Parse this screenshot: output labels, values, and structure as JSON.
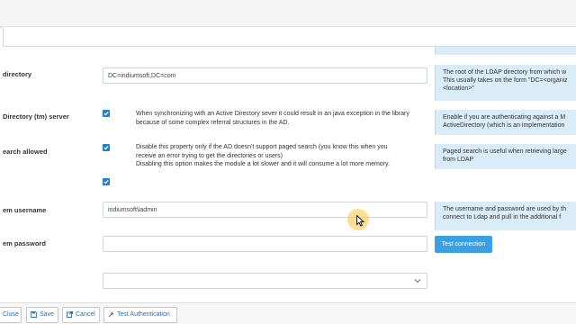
{
  "fields": [
    {
      "label": "directory",
      "value": "DC=indiumsoft,DC=com"
    },
    {
      "label": "Directory (tm) server",
      "checked": true,
      "description": "When synchronizing with an Active Directory sever it could result in an java exception in the library because of some complex referral structures in the AD."
    },
    {
      "label": "earch allowed",
      "checked": true,
      "description_lines": [
        "Disable this property only if the AD doesn't support paged search (you know this when you",
        "receive an error trying to get the directories or users)",
        "Disabling this option makes the module a lot slower and it will consume a lot more memory."
      ]
    },
    {
      "label": "",
      "checked": true
    },
    {
      "label": "em username",
      "value": "indiumsoft\\iadmin"
    },
    {
      "label": "em password",
      "value": ""
    },
    {
      "label": "",
      "value": ""
    }
  ],
  "help": [
    {
      "lines": [
        "The root of the LDAP directory from which w",
        "This usually takes on the form \"DC=<organiz",
        "<location>\""
      ]
    },
    {
      "lines": [
        "Enable if you are authenticating against a M",
        "ActiveDirectory (which is an implementation"
      ]
    },
    {
      "lines": [
        "Paged search is useful when retrieving large",
        "from LDAP"
      ]
    },
    {
      "lines": [
        "The username and password are used by th",
        "connect to Ldap and pull in the additional f"
      ]
    }
  ],
  "test_connection_label": "Test connection",
  "footer": {
    "close": "Close",
    "save": "Save",
    "cancel": "Cancel",
    "test_auth": "Test Authentication"
  },
  "colors": {
    "accent": "#3aa0e3",
    "checkbox": "#1f7fd0",
    "help_bg": "#d9ecf8",
    "cursor_highlight": "#ffc43c"
  },
  "icons": [
    "check-icon",
    "chevron-down-icon",
    "close-icon",
    "save-icon",
    "cancel-icon",
    "test-authentication-icon",
    "mouse-pointer-icon"
  ]
}
